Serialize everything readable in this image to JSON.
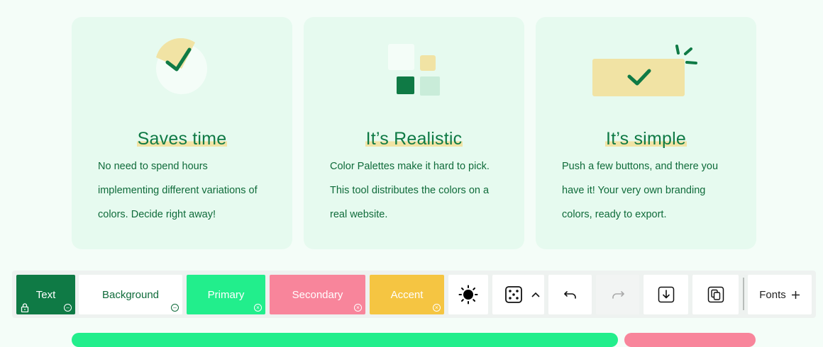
{
  "features": [
    {
      "title": "Saves time",
      "lines": [
        "No need to spend hours",
        "implementing different variations of",
        "colors. Decide right away!"
      ],
      "icon": "clock-check-icon"
    },
    {
      "title": "It’s Realistic",
      "lines": [
        "Color Palettes make it hard to pick.",
        "This tool distributes the colors on a",
        "real website."
      ],
      "icon": "palette-squares-icon"
    },
    {
      "title": "It’s simple",
      "lines": [
        "Push a few buttons, and there you",
        "have it! Your very own branding",
        "colors, ready to export."
      ],
      "icon": "sparkle-check-icon"
    }
  ],
  "toolbar": {
    "swatches": [
      {
        "label": "Text",
        "color": "#0f7a45",
        "text_color": "#ffffff",
        "locked": true
      },
      {
        "label": "Background",
        "color": "#ffffff",
        "text_color": "#0f6b3a",
        "locked": false
      },
      {
        "label": "Primary",
        "color": "#22ee8c",
        "text_color": "#ffffff",
        "locked": false
      },
      {
        "label": "Secondary",
        "color": "#f8859b",
        "text_color": "#ffffff",
        "locked": false
      },
      {
        "label": "Accent",
        "color": "#f5c542",
        "text_color": "#ffffff",
        "locked": false
      }
    ],
    "buttons": [
      {
        "name": "theme-toggle-button",
        "icon": "sun-icon"
      },
      {
        "name": "randomize-button",
        "icon": "dice-icon"
      },
      {
        "name": "randomize-options-button",
        "icon": "chevron-up-icon"
      },
      {
        "name": "undo-button",
        "icon": "undo-icon"
      },
      {
        "name": "redo-button",
        "icon": "redo-icon",
        "disabled": true
      },
      {
        "name": "download-button",
        "icon": "download-icon"
      },
      {
        "name": "copy-button",
        "icon": "copy-icon"
      }
    ],
    "fonts_label": "Fonts",
    "fonts_icon": "plus-icon"
  },
  "colors": {
    "page_bg": "#f4fdf8",
    "card_bg": "#e6faef",
    "dark_green": "#0f7a45",
    "yellow": "#f1e3a4",
    "primary": "#22ee8c",
    "secondary": "#f8859b"
  }
}
